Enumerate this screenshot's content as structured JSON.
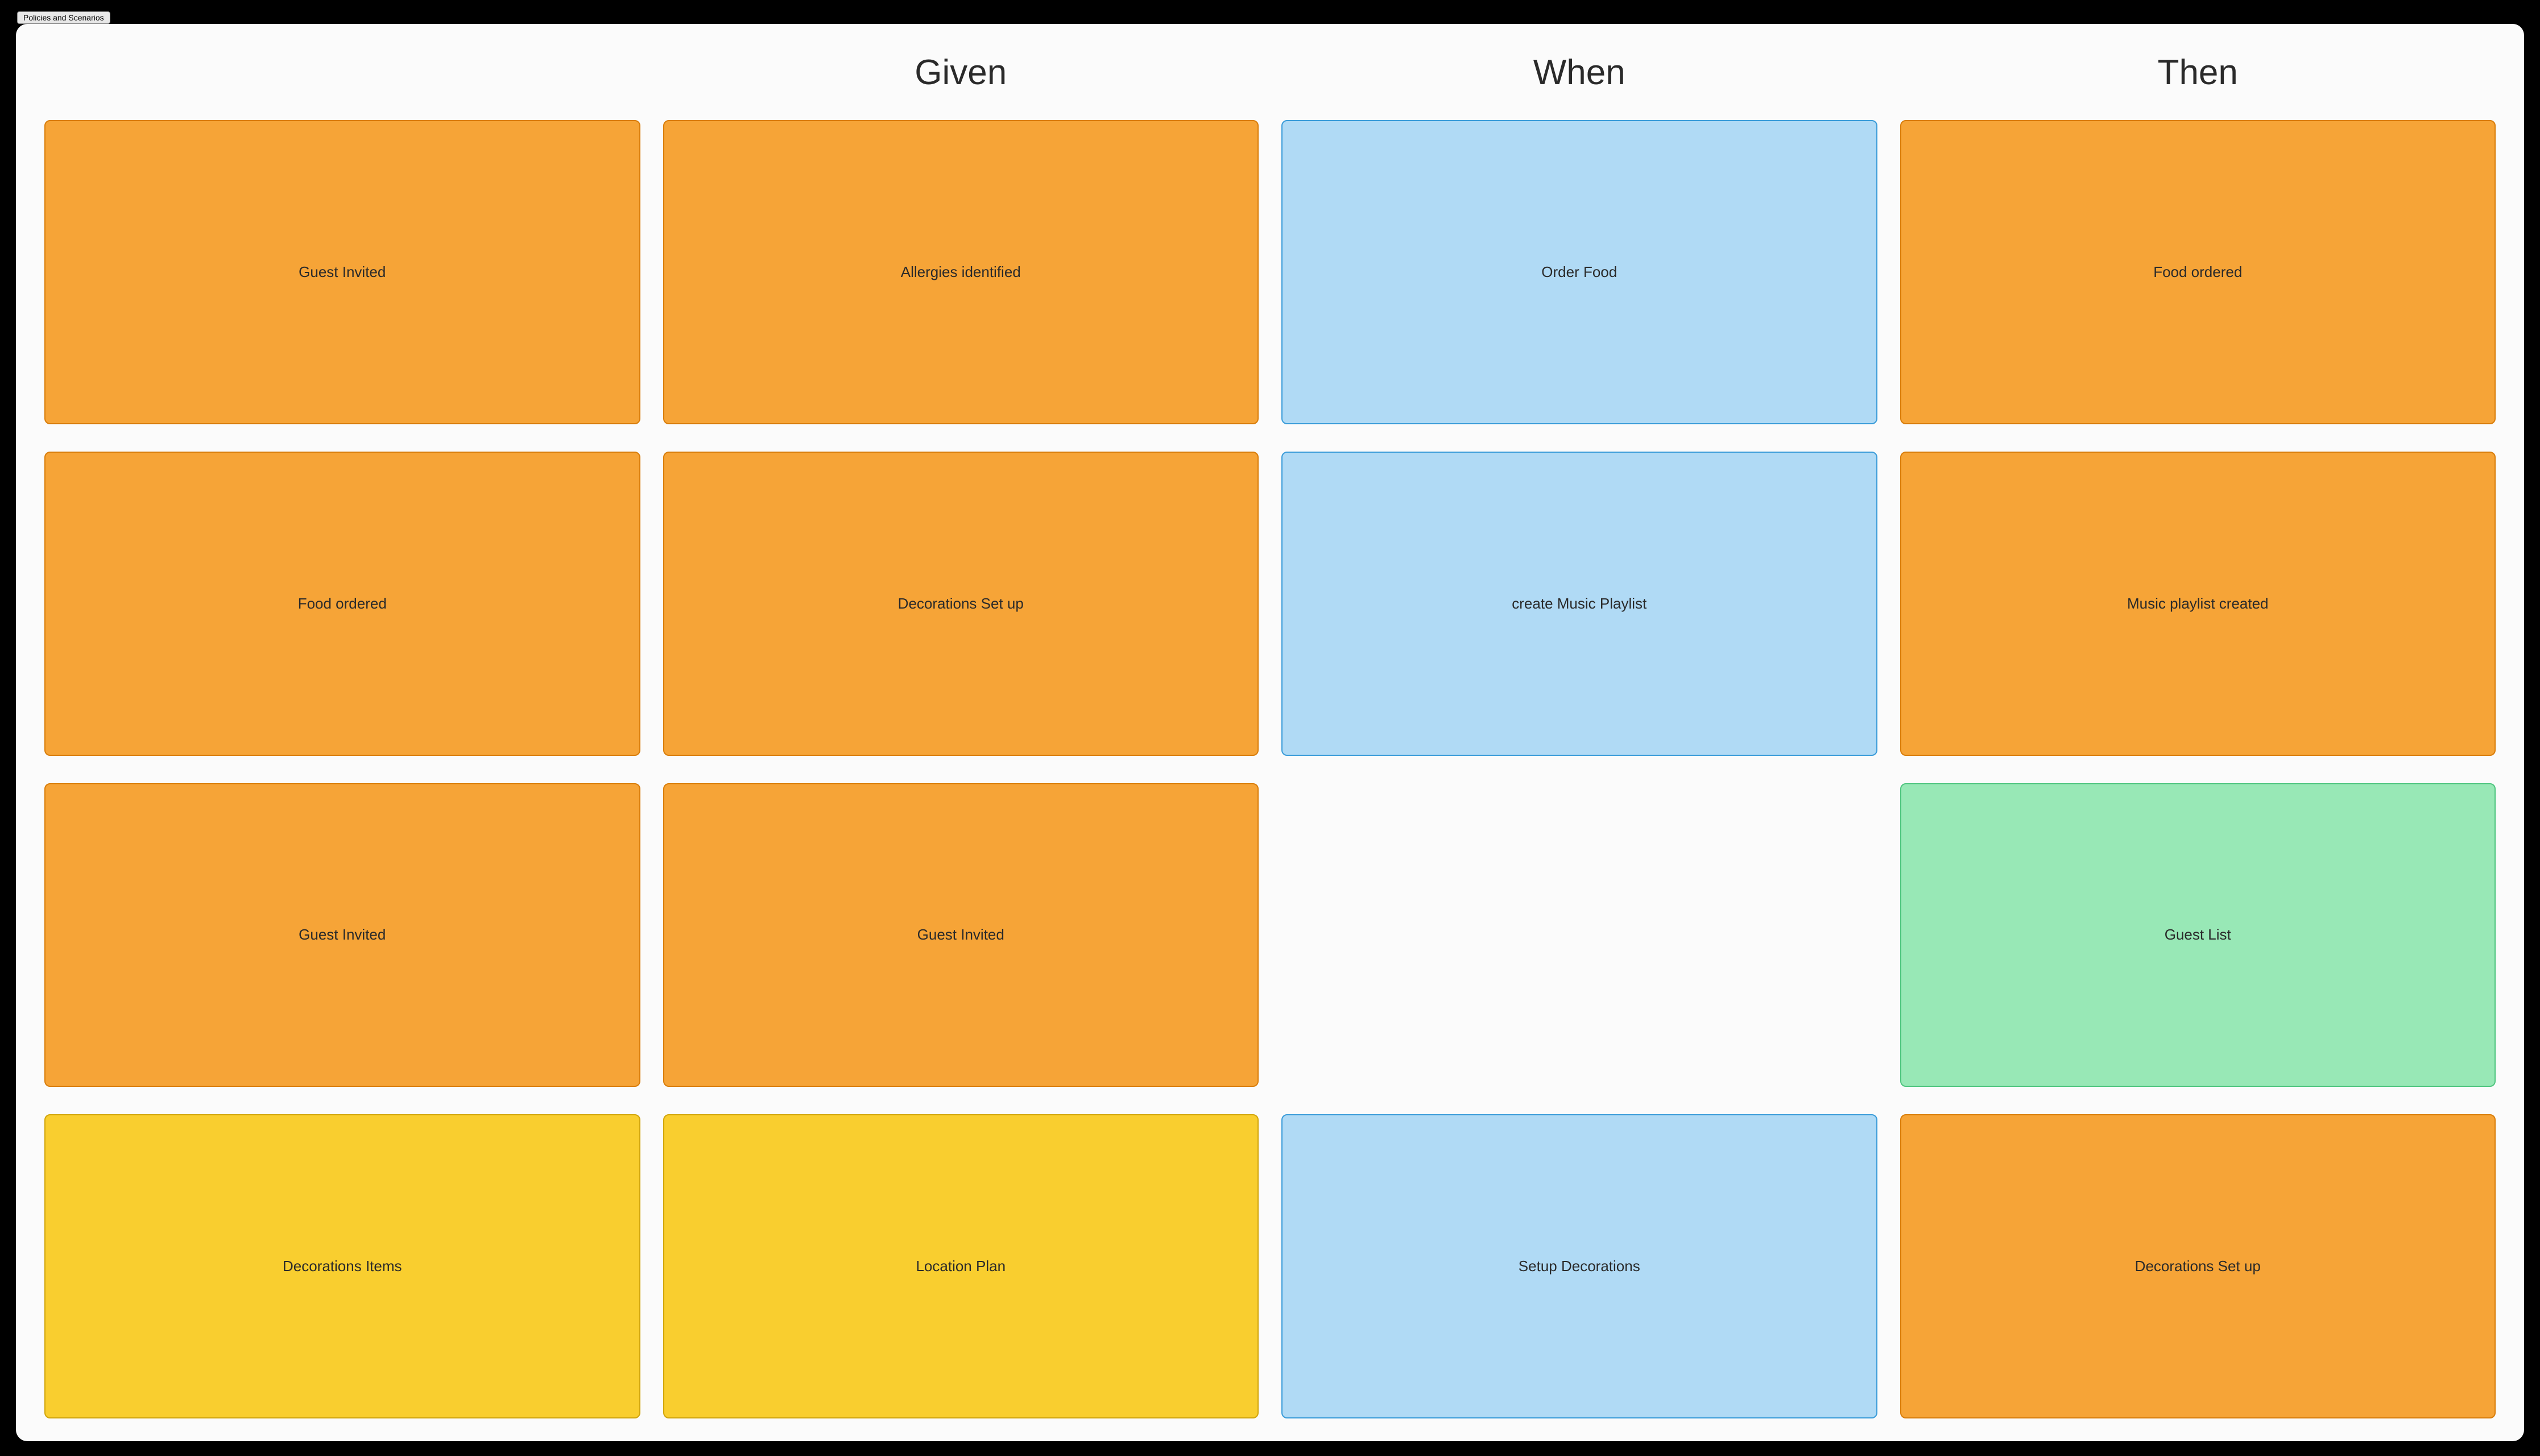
{
  "tab": {
    "label": "Policies and Scenarios"
  },
  "headers": {
    "h0": "",
    "h1": "Given",
    "h2": "When",
    "h3": "Then"
  },
  "rows": {
    "r0": {
      "c0": "Guest Invited",
      "c1": "Allergies identified",
      "c2": "Order Food",
      "c3": "Food ordered"
    },
    "r1": {
      "c0": "Food ordered",
      "c1": "Decorations Set up",
      "c2": "create Music Playlist",
      "c3": "Music playlist created"
    },
    "r2": {
      "c0": "Guest Invited",
      "c1": "Guest Invited",
      "c3": "Guest List"
    },
    "r3": {
      "c0": "Decorations Items",
      "c1": "Location Plan",
      "c2": "Setup Decorations",
      "c3": "Decorations Set up"
    }
  }
}
